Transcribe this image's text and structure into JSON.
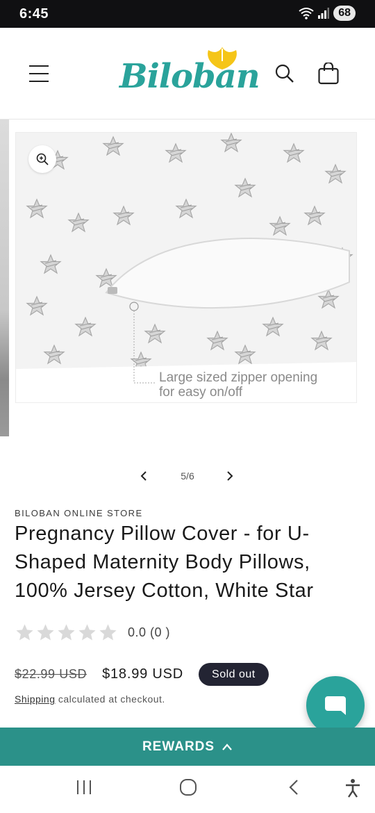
{
  "status_bar": {
    "time": "6:45",
    "battery": "68",
    "wifi_icon": "wifi-icon",
    "signal_icon": "signal-icon"
  },
  "header": {
    "logo_text": "Biloban",
    "icons": {
      "menu": "hamburger-menu-icon",
      "search": "search-icon",
      "cart": "cart-icon"
    },
    "brand_color": "#2aa39b"
  },
  "gallery": {
    "image_caption_line1": "Large sized zipper opening",
    "image_caption_line2": "for easy on/off",
    "counter": "5/6",
    "zoom_icon": "zoom-in-icon"
  },
  "product": {
    "vendor": "BILOBAN ONLINE STORE",
    "title": "Pregnancy Pillow Cover - for U-Shaped Maternity Body Pillows, 100% Jersey Cotton, White Star",
    "rating": 0,
    "rating_text": "0.0 (0 )",
    "old_price": "$22.99 USD",
    "price": "$18.99 USD",
    "badge": "Sold out",
    "shipping_link": "Shipping",
    "shipping_rest": " calculated at checkout."
  },
  "rewards": {
    "label": "REWARDS",
    "bar_color": "#2b9189"
  },
  "chat": {
    "icon": "chat-bubble-icon"
  },
  "nav_bar": {
    "icons": [
      "recents-icon",
      "home-icon",
      "back-icon",
      "accessibility-icon"
    ]
  }
}
